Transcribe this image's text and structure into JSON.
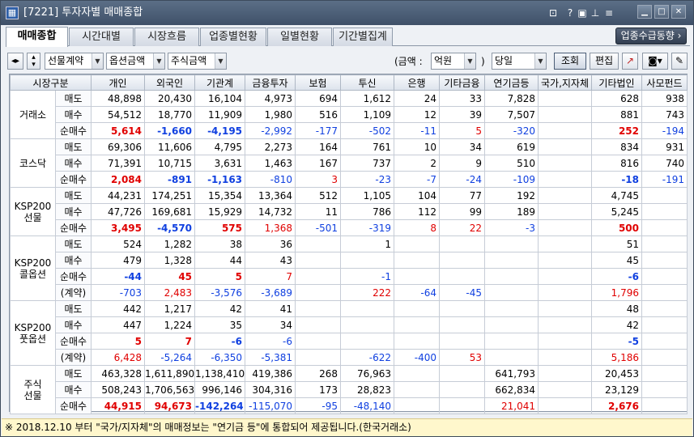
{
  "window": {
    "title": "[7221] 투자자별 매매종합"
  },
  "tabs": [
    "매매종합",
    "시간대별",
    "시장흐름",
    "업종별현황",
    "일별현황",
    "기간별집계"
  ],
  "special_button": "업종수급동향 ›",
  "toolbar": {
    "select_contract": "선물계약",
    "select_option_amount": "옵션금액",
    "select_stock_amount": "주식금액",
    "amount_label_prefix": "(금액 :",
    "amount_unit": "억원",
    "amount_label_suffix": ")",
    "period": "당일",
    "query_button": "조회",
    "edit_button": "편집"
  },
  "columns": [
    "시장구분",
    "개인",
    "외국인",
    "기관계",
    "금융투자",
    "보험",
    "투신",
    "은행",
    "기타금융",
    "연기금등",
    "국가,지자체",
    "기타법인",
    "사모펀드"
  ],
  "sections": [
    {
      "name": "거래소",
      "rows": [
        {
          "label": "매도",
          "values": [
            "48,898",
            "20,430",
            "16,104",
            "4,973",
            "694",
            "1,612",
            "24",
            "33",
            "7,828",
            "",
            "628",
            "938"
          ]
        },
        {
          "label": "매수",
          "values": [
            "54,512",
            "18,770",
            "11,909",
            "1,980",
            "516",
            "1,109",
            "12",
            "39",
            "7,507",
            "",
            "881",
            "743"
          ]
        },
        {
          "label": "순매수",
          "values": [
            "5,614",
            "-1,660",
            "-4,195",
            "-2,992",
            "-177",
            "-502",
            "-11",
            "5",
            "-320",
            "",
            "252",
            "-194"
          ]
        }
      ]
    },
    {
      "name": "코스닥",
      "rows": [
        {
          "label": "매도",
          "values": [
            "69,306",
            "11,606",
            "4,795",
            "2,273",
            "164",
            "761",
            "10",
            "34",
            "619",
            "",
            "834",
            "931"
          ]
        },
        {
          "label": "매수",
          "values": [
            "71,391",
            "10,715",
            "3,631",
            "1,463",
            "167",
            "737",
            "2",
            "9",
            "510",
            "",
            "816",
            "740"
          ]
        },
        {
          "label": "순매수",
          "values": [
            "2,084",
            "-891",
            "-1,163",
            "-810",
            "3",
            "-23",
            "-7",
            "-24",
            "-109",
            "",
            "-18",
            "-191"
          ]
        }
      ]
    },
    {
      "name": "KSP200\n선물",
      "rows": [
        {
          "label": "매도",
          "values": [
            "44,231",
            "174,251",
            "15,354",
            "13,364",
            "512",
            "1,105",
            "104",
            "77",
            "192",
            "",
            "4,745",
            ""
          ]
        },
        {
          "label": "매수",
          "values": [
            "47,726",
            "169,681",
            "15,929",
            "14,732",
            "11",
            "786",
            "112",
            "99",
            "189",
            "",
            "5,245",
            ""
          ]
        },
        {
          "label": "순매수",
          "values": [
            "3,495",
            "-4,570",
            "575",
            "1,368",
            "-501",
            "-319",
            "8",
            "22",
            "-3",
            "",
            "500",
            ""
          ]
        }
      ]
    },
    {
      "name": "KSP200\n콜옵션",
      "rows": [
        {
          "label": "매도",
          "values": [
            "524",
            "1,282",
            "38",
            "36",
            "",
            "1",
            "",
            "",
            "",
            "",
            "51",
            ""
          ]
        },
        {
          "label": "매수",
          "values": [
            "479",
            "1,328",
            "44",
            "43",
            "",
            "",
            "",
            "",
            "",
            "",
            "45",
            ""
          ]
        },
        {
          "label": "순매수",
          "values": [
            "-44",
            "45",
            "5",
            "7",
            "",
            "-1",
            "",
            "",
            "",
            "",
            "-6",
            ""
          ]
        },
        {
          "label": "(계약)",
          "values": [
            "-703",
            "2,483",
            "-3,576",
            "-3,689",
            "",
            "222",
            "-64",
            "-45",
            "",
            "",
            "1,796",
            ""
          ]
        }
      ]
    },
    {
      "name": "KSP200\n풋옵션",
      "rows": [
        {
          "label": "매도",
          "values": [
            "442",
            "1,217",
            "42",
            "41",
            "",
            "",
            "",
            "",
            "",
            "",
            "48",
            ""
          ]
        },
        {
          "label": "매수",
          "values": [
            "447",
            "1,224",
            "35",
            "34",
            "",
            "",
            "",
            "",
            "",
            "",
            "42",
            ""
          ]
        },
        {
          "label": "순매수",
          "values": [
            "5",
            "7",
            "-6",
            "-6",
            "",
            "",
            "",
            "",
            "",
            "",
            "-5",
            ""
          ]
        },
        {
          "label": "(계약)",
          "values": [
            "6,428",
            "-5,264",
            "-6,350",
            "-5,381",
            "",
            "-622",
            "-400",
            "53",
            "",
            "",
            "5,186",
            ""
          ]
        }
      ]
    },
    {
      "name": "주식\n선물",
      "rows": [
        {
          "label": "매도",
          "values": [
            "463,328",
            "1,611,890",
            "1,138,410",
            "419,386",
            "268",
            "76,963",
            "",
            "",
            "641,793",
            "",
            "20,453",
            ""
          ]
        },
        {
          "label": "매수",
          "values": [
            "508,243",
            "1,706,563",
            "996,146",
            "304,316",
            "173",
            "28,823",
            "",
            "",
            "662,834",
            "",
            "23,129",
            ""
          ]
        },
        {
          "label": "순매수",
          "values": [
            "44,915",
            "94,673",
            "-142,264",
            "-115,070",
            "-95",
            "-48,140",
            "",
            "",
            "21,041",
            "",
            "2,676",
            ""
          ]
        }
      ]
    }
  ],
  "footer": "※ 2018.12.10 부터 \"국가/지자체\"의 매매정보는 \"연기금 등\"에 통합되어 제공됩니다.(한국거래소)",
  "colors": {
    "positive": "#e00000",
    "negative": "#1040e0"
  }
}
